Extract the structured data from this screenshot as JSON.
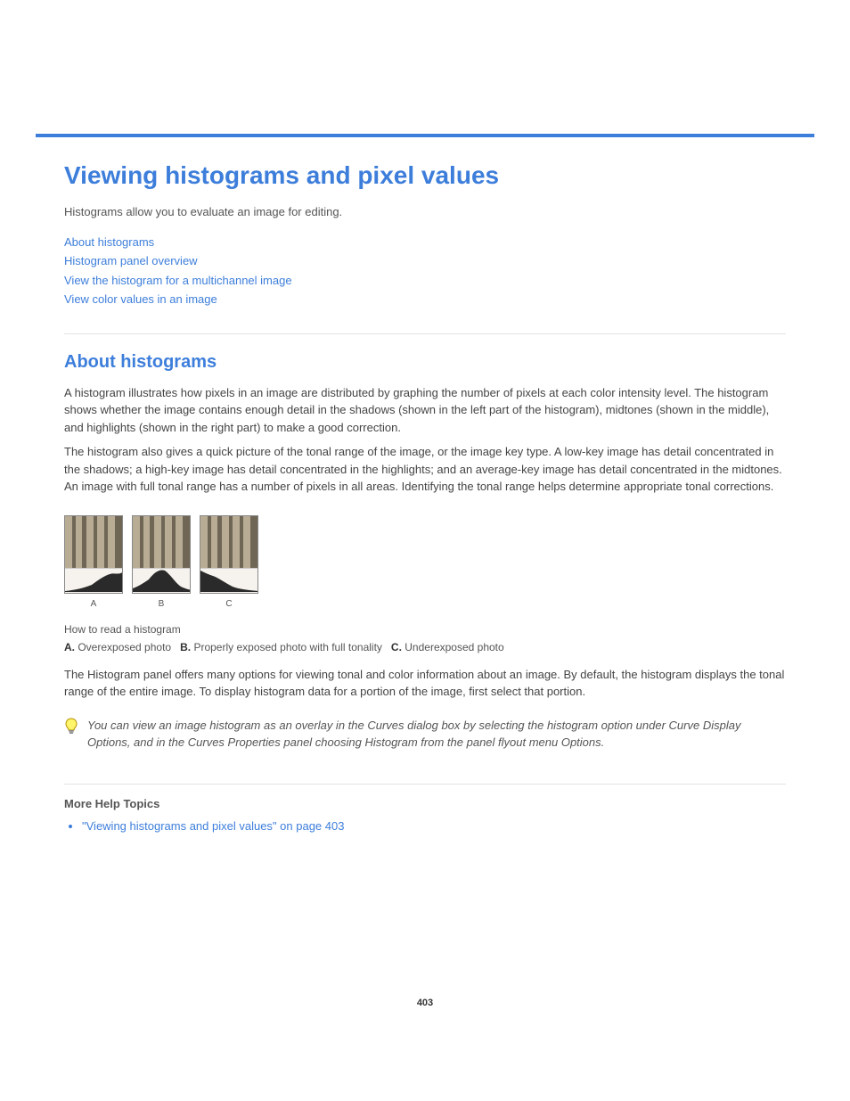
{
  "page": {
    "title": "Viewing histograms and pixel values",
    "intro": "Histograms allow you to evaluate an image for editing.",
    "nav_links": [
      "About histograms",
      "Histogram panel overview",
      "View the histogram for a multichannel image",
      "View color values in an image"
    ],
    "page_number": "403"
  },
  "section1": {
    "heading": "About histograms",
    "p1": "A histogram illustrates how pixels in an image are distributed by graphing the number of pixels at each color intensity level. The histogram shows whether the image contains enough detail in the shadows (shown in the left part of the histogram), midtones (shown in the middle), and highlights (shown in the right part) to make a good correction.",
    "p2": "The histogram also gives a quick picture of the tonal range of the image, or the image key type. A low-key image has detail concentrated in the shadows; a high-key image has detail concentrated in the highlights; and an average-key image has detail concentrated in the midtones. An image with full tonal range has a number of pixels in all areas. Identifying the tonal range helps determine appropriate tonal corrections.",
    "figure": {
      "caption_title": "How to read a histogram",
      "labels": [
        "A",
        "B",
        "C"
      ],
      "items": [
        {
          "key": "A.",
          "text": "Overexposed photo"
        },
        {
          "key": "B.",
          "text": "Properly exposed photo with full tonality"
        },
        {
          "key": "C.",
          "text": "Underexposed photo"
        }
      ]
    },
    "p3": "The Histogram panel offers many options for viewing tonal and color information about an image. By default, the histogram displays the tonal range of the entire image. To display histogram data for a portion of the image, first select that portion.",
    "tip": "You can view an image histogram as an overlay in the Curves dialog box by selecting the histogram option under Curve Display Options, and in the Curves Properties panel choosing Histogram from the panel flyout menu Options."
  },
  "more_help": {
    "title": "More Help Topics",
    "link": "\"Viewing histograms and pixel values\" on page 403"
  },
  "icons": {
    "bulb": "lightbulb-tip-icon"
  }
}
